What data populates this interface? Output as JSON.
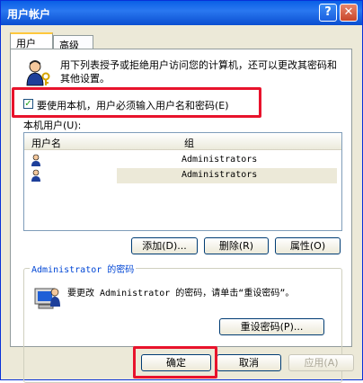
{
  "window": {
    "title": "用户帐户"
  },
  "titlebar": {
    "help_glyph": "?",
    "close_glyph": "✕"
  },
  "tabs": [
    {
      "label": "用户"
    },
    {
      "label": "高级"
    }
  ],
  "main": {
    "description": "用下列表授予或拒绝用户访问您的计算机，还可以更改其密码和其他设置。",
    "require_login_checked": true,
    "require_login_label": "要使用本机，用户必须输入用户名和密码(E)",
    "local_users_label": "本机用户(U):",
    "columns": [
      "用户名",
      "组"
    ],
    "rows": [
      {
        "username": "",
        "group": "Administrators"
      },
      {
        "username": "",
        "group": "Administrators"
      }
    ],
    "buttons": {
      "add": "添加(D)...",
      "remove": "删除(R)",
      "properties": "属性(O)"
    }
  },
  "password_group": {
    "title": "Administrator 的密码",
    "text": "要更改 Administrator 的密码，请单击“重设密码”。",
    "reset_button": "重设密码(P)..."
  },
  "footer": {
    "ok": "确定",
    "cancel": "取消",
    "apply": "应用(A)"
  },
  "colors": {
    "title_bar": "#0a5fe6",
    "highlight_box": "#e8132c",
    "selected_row": "#ece9d8"
  }
}
